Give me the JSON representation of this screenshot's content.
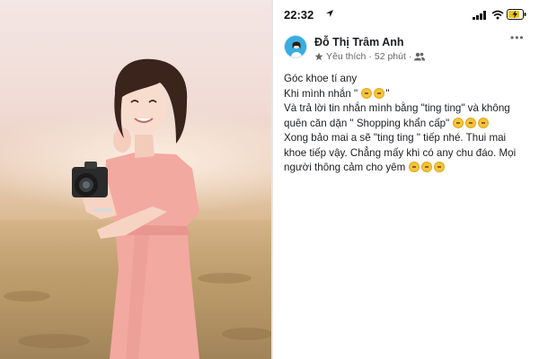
{
  "status_bar": {
    "time": "22:32"
  },
  "post": {
    "author": "Đỗ Thị Trâm Anh",
    "reaction": "Yêu thích",
    "time_ago": "52 phút",
    "separator": "·",
    "lines": [
      {
        "text": "Góc khoe tí any",
        "emoji_after": 0
      },
      {
        "text": "Khi mình nhắn \" ",
        "emoji_after": 2,
        "suffix": "\""
      },
      {
        "text": "Và trả lời tin nhắn mình bằng \"ting ting\" và không",
        "emoji_after": 0
      },
      {
        "text": "quên căn dặn \" Shopping khẩn cấp\" ",
        "emoji_after": 3
      },
      {
        "text": "Xong bảo mai a sẽ \"ting ting \" tiếp nhé. Thui mai",
        "emoji_after": 0
      },
      {
        "text": "khoe tiếp vậy. Chẳng mấy khi có any chu đáo. Mọi",
        "emoji_after": 0
      },
      {
        "text": "người thông cảm cho yêm ",
        "emoji_after": 3
      }
    ]
  },
  "icons": {
    "location": "location-arrow-icon",
    "signal": "signal-bars-icon",
    "wifi": "wifi-icon",
    "battery": "battery-charging-icon",
    "reaction": "star-icon",
    "audience": "friends-icon",
    "more": "more-options-icon"
  },
  "colors": {
    "text_primary": "#1c1e21",
    "text_secondary": "#65676b",
    "dress_pink": "#f2a9a0",
    "emoji_yellow": "#f5c33b"
  }
}
